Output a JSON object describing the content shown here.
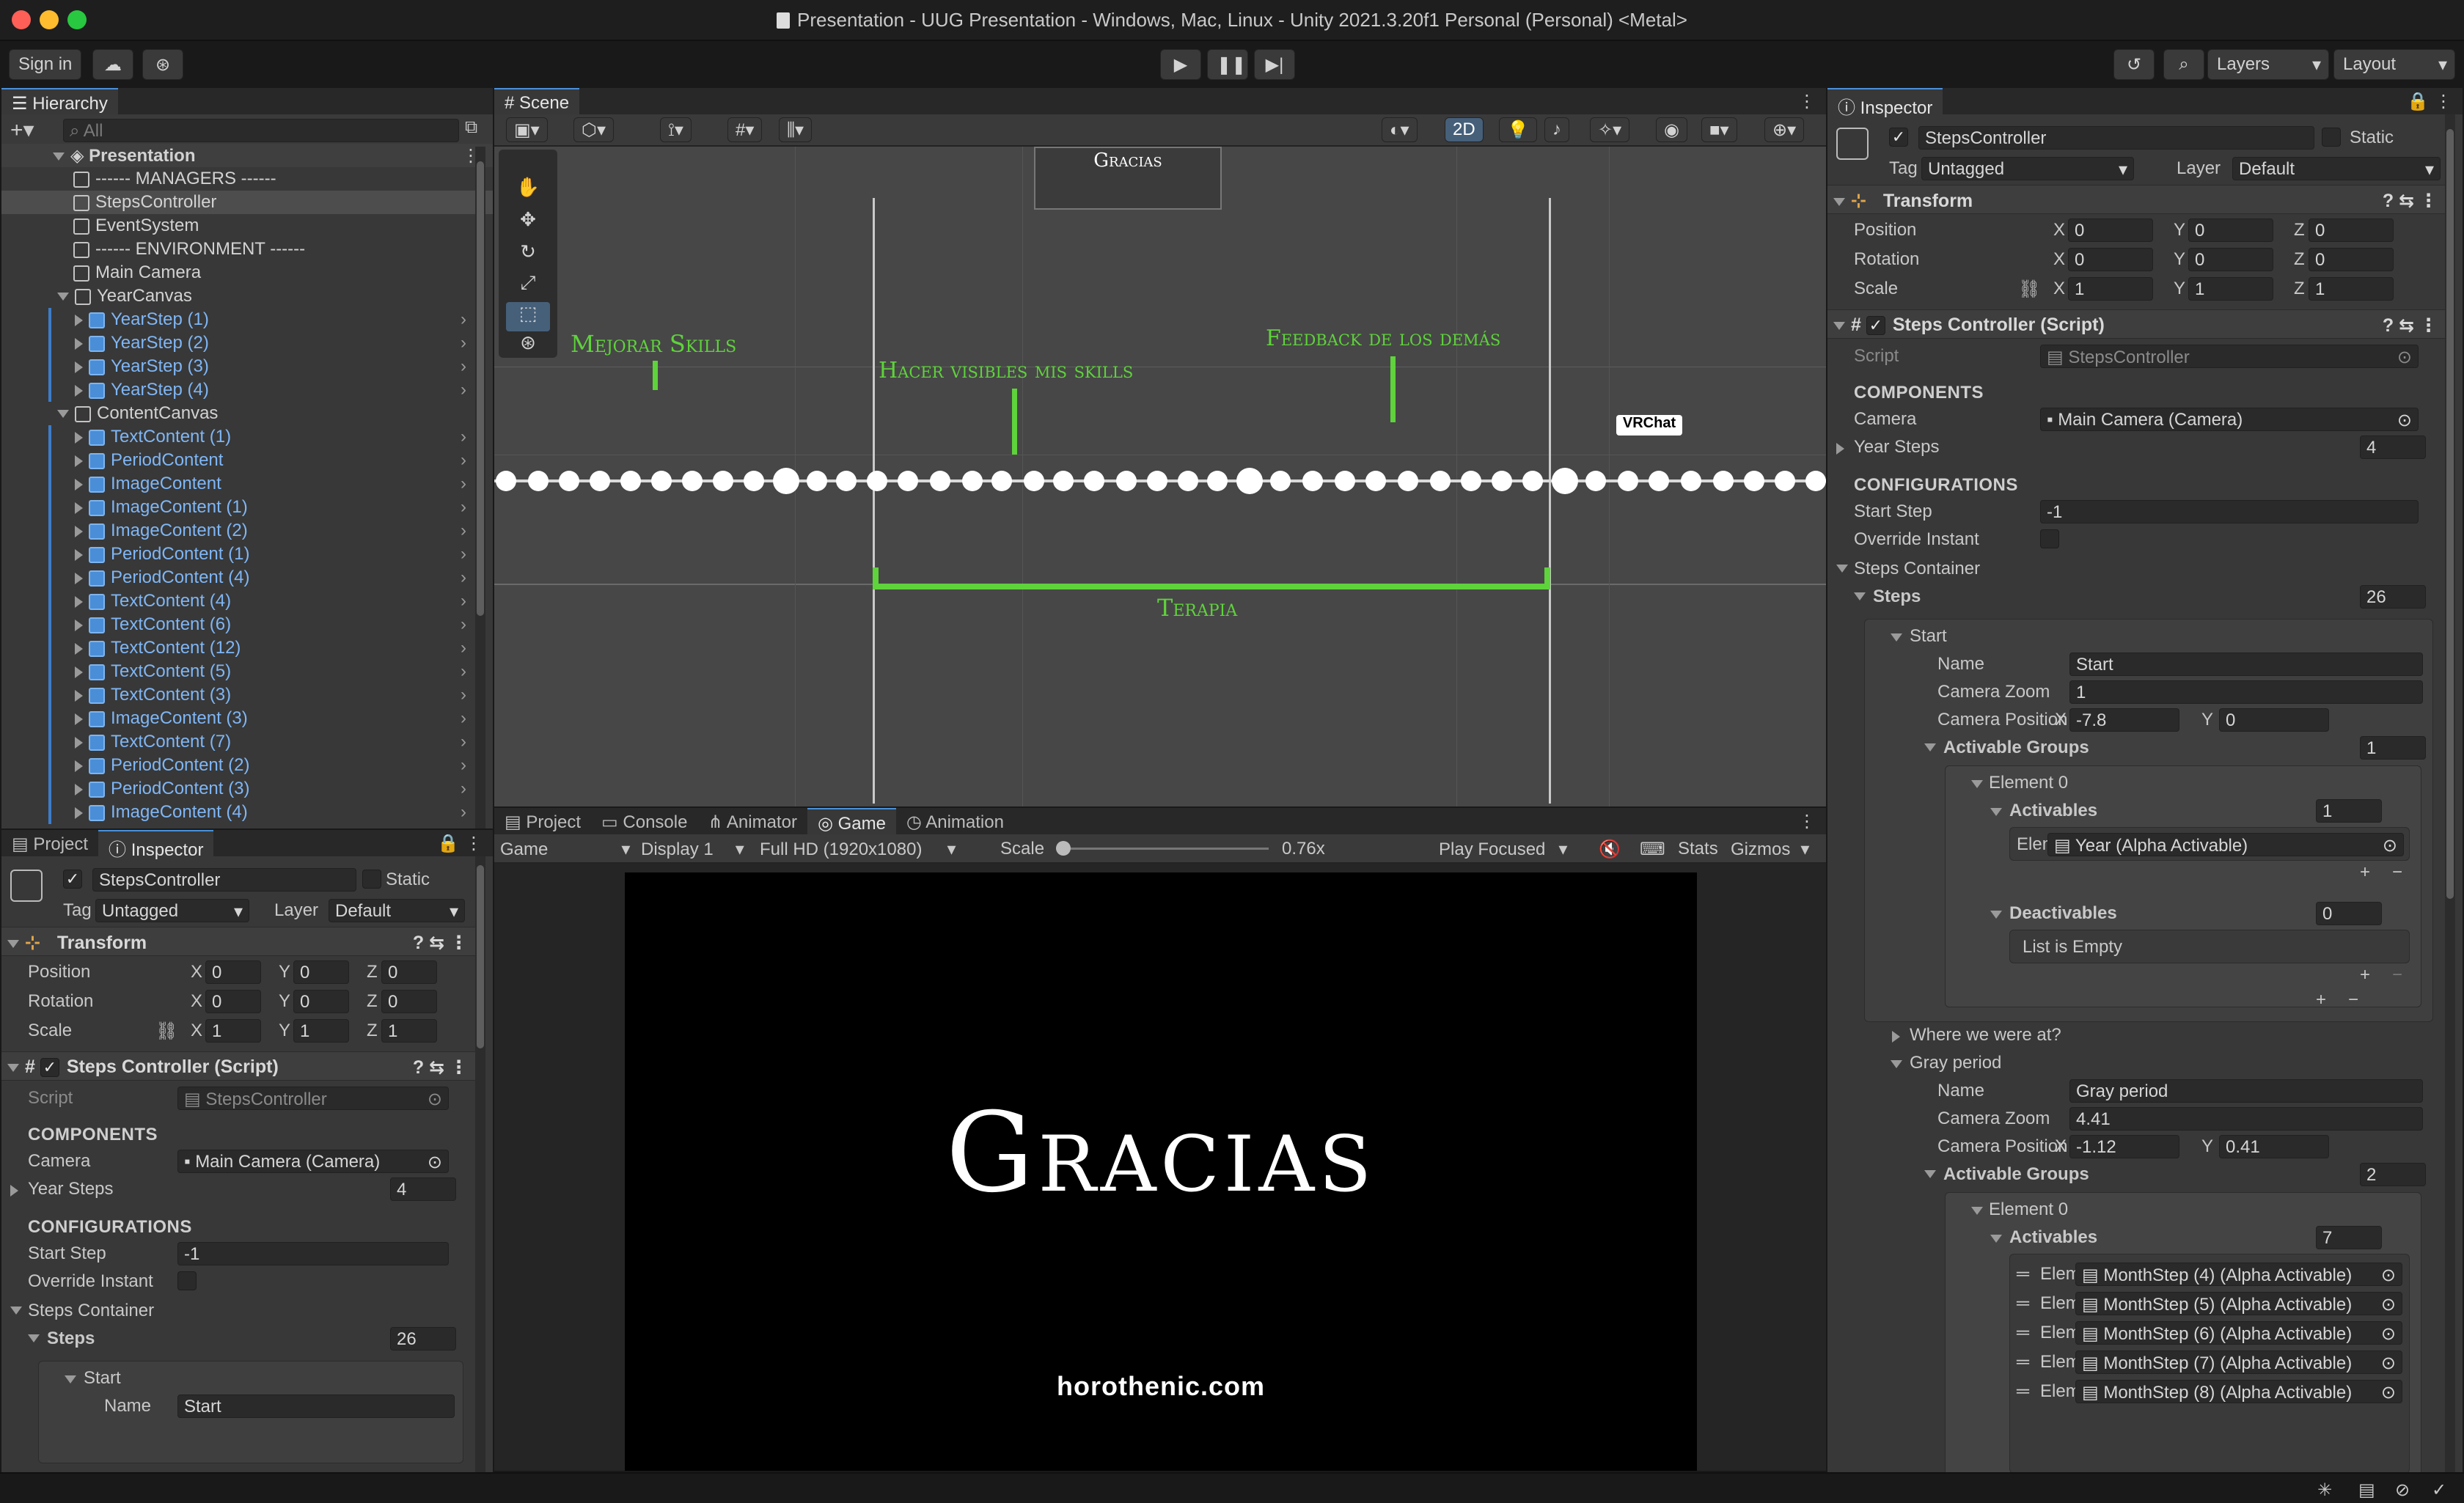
{
  "window": {
    "title": "Presentation - UUG Presentation - Windows, Mac, Linux - Unity 2021.3.20f1 Personal (Personal) <Metal>"
  },
  "toolbar": {
    "sign_in": "Sign in",
    "layers": "Layers",
    "layout": "Layout"
  },
  "hierarchy": {
    "tab": "Hierarchy",
    "search_placeholder": "All",
    "scene": "Presentation",
    "items": [
      {
        "label": "------ MANAGERS ------",
        "depth": 1,
        "prefab": false,
        "arrow": false
      },
      {
        "label": "StepsController",
        "depth": 1,
        "prefab": false,
        "arrow": false,
        "selected": true
      },
      {
        "label": "EventSystem",
        "depth": 1,
        "prefab": false,
        "arrow": false
      },
      {
        "label": "------ ENVIRONMENT ------",
        "depth": 1,
        "prefab": false,
        "arrow": false
      },
      {
        "label": "Main Camera",
        "depth": 1,
        "prefab": false,
        "arrow": false
      },
      {
        "label": "YearCanvas",
        "depth": 1,
        "prefab": false,
        "arrow": true,
        "expanded": true
      },
      {
        "label": "YearStep (1)",
        "depth": 2,
        "prefab": true,
        "arrow": true
      },
      {
        "label": "YearStep (2)",
        "depth": 2,
        "prefab": true,
        "arrow": true
      },
      {
        "label": "YearStep (3)",
        "depth": 2,
        "prefab": true,
        "arrow": true
      },
      {
        "label": "YearStep (4)",
        "depth": 2,
        "prefab": true,
        "arrow": true
      },
      {
        "label": "ContentCanvas",
        "depth": 1,
        "prefab": false,
        "arrow": true,
        "expanded": true
      },
      {
        "label": "TextContent (1)",
        "depth": 2,
        "prefab": true,
        "arrow": true
      },
      {
        "label": "PeriodContent",
        "depth": 2,
        "prefab": true,
        "arrow": true
      },
      {
        "label": "ImageContent",
        "depth": 2,
        "prefab": true,
        "arrow": true
      },
      {
        "label": "ImageContent (1)",
        "depth": 2,
        "prefab": true,
        "arrow": true
      },
      {
        "label": "ImageContent (2)",
        "depth": 2,
        "prefab": true,
        "arrow": true
      },
      {
        "label": "PeriodContent (1)",
        "depth": 2,
        "prefab": true,
        "arrow": true
      },
      {
        "label": "PeriodContent (4)",
        "depth": 2,
        "prefab": true,
        "arrow": true
      },
      {
        "label": "TextContent (4)",
        "depth": 2,
        "prefab": true,
        "arrow": true
      },
      {
        "label": "TextContent (6)",
        "depth": 2,
        "prefab": true,
        "arrow": true
      },
      {
        "label": "TextContent (12)",
        "depth": 2,
        "prefab": true,
        "arrow": true
      },
      {
        "label": "TextContent (5)",
        "depth": 2,
        "prefab": true,
        "arrow": true
      },
      {
        "label": "TextContent (3)",
        "depth": 2,
        "prefab": true,
        "arrow": true
      },
      {
        "label": "ImageContent (3)",
        "depth": 2,
        "prefab": true,
        "arrow": true
      },
      {
        "label": "TextContent (7)",
        "depth": 2,
        "prefab": true,
        "arrow": true
      },
      {
        "label": "PeriodContent (2)",
        "depth": 2,
        "prefab": true,
        "arrow": true
      },
      {
        "label": "PeriodContent (3)",
        "depth": 2,
        "prefab": true,
        "arrow": true
      },
      {
        "label": "ImageContent (4)",
        "depth": 2,
        "prefab": true,
        "arrow": true
      }
    ]
  },
  "scene": {
    "tab": "Scene",
    "mode_2d": "2D",
    "labels": {
      "gracias": "Gracias",
      "mejorar": "Mejorar Skills",
      "hacer": "Hacer visibles mis skills",
      "feedback": "Feedback de los demás",
      "terapia": "Terapia",
      "vrchat": "VRChat"
    }
  },
  "bottom_tabs": {
    "project": "Project",
    "console": "Console",
    "animator": "Animator",
    "game": "Game",
    "animation": "Animation"
  },
  "game": {
    "mode": "Game",
    "display": "Display 1",
    "resolution": "Full HD (1920x1080)",
    "scale_label": "Scale",
    "scale_value": "0.76x",
    "scale_fraction": 0.0,
    "play_focused": "Play Focused",
    "stats": "Stats",
    "gizmos": "Gizmos",
    "title": "Gracias",
    "url": "horothenic.com"
  },
  "inspector": {
    "tab": "Inspector",
    "project_tab": "Project",
    "object_name": "StepsController",
    "static_label": "Static",
    "tag_label": "Tag",
    "tag_value": "Untagged",
    "layer_label": "Layer",
    "layer_value": "Default",
    "transform": {
      "title": "Transform",
      "position": "Position",
      "rotation": "Rotation",
      "scale": "Scale",
      "x": "X",
      "y": "Y",
      "z": "Z",
      "pos": [
        "0",
        "0",
        "0"
      ],
      "rot": [
        "0",
        "0",
        "0"
      ],
      "scl": [
        "1",
        "1",
        "1"
      ]
    },
    "script": {
      "title": "Steps Controller (Script)",
      "script_label": "Script",
      "script_value": "StepsController",
      "components": "COMPONENTS",
      "camera_label": "Camera",
      "camera_value": "Main Camera (Camera)",
      "year_steps": "Year Steps",
      "year_steps_value": "4",
      "configurations": "CONFIGURATIONS",
      "start_step": "Start Step",
      "start_step_value": "-1",
      "override_instant": "Override Instant",
      "steps_container": "Steps Container",
      "steps": "Steps",
      "steps_count": "26",
      "start": "Start",
      "name_label": "Name",
      "start_name": "Start",
      "camera_zoom": "Camera Zoom",
      "start_zoom": "1",
      "camera_position": "Camera Position",
      "start_pos_x": "-7.8",
      "start_pos_y": "0",
      "activable_groups": "Activable Groups",
      "start_groups": "1",
      "element0": "Element 0",
      "activables": "Activables",
      "start_activables": "1",
      "elem_short": "Elem",
      "year_activable": "Year (Alpha Activable)",
      "deactivables": "Deactivables",
      "deactivables_count": "0",
      "list_empty": "List is Empty",
      "where": "Where we were at?",
      "gray": "Gray period",
      "gray_name": "Gray period",
      "gray_zoom": "4.41",
      "gray_pos_x": "-1.12",
      "gray_pos_y": "0.41",
      "gray_groups": "2",
      "gray_activables": "7",
      "month_items": [
        "MonthStep (4) (Alpha Activable)",
        "MonthStep (5) (Alpha Activable)",
        "MonthStep (6) (Alpha Activable)",
        "MonthStep (7) (Alpha Activable)",
        "MonthStep (8) (Alpha Activable)"
      ]
    }
  },
  "colors": {
    "accent_green": "#5ed33b",
    "selection": "#4d4d4d",
    "prefab_blue": "#7fb6f5"
  }
}
